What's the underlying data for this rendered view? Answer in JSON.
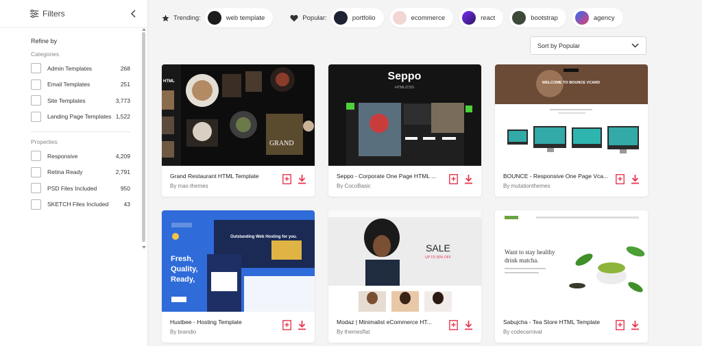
{
  "sidebar": {
    "title": "Filters",
    "refine_label": "Refine by",
    "categories_label": "Categories",
    "categories": [
      {
        "label": "Admin Templates",
        "count": "268"
      },
      {
        "label": "Email Templates",
        "count": "251"
      },
      {
        "label": "Site Templates",
        "count": "3,773"
      },
      {
        "label": "Landing Page Templates",
        "count": "1,522"
      }
    ],
    "properties_label": "Properties",
    "properties": [
      {
        "label": "Responsive",
        "count": "4,209"
      },
      {
        "label": "Retina Ready",
        "count": "2,791"
      },
      {
        "label": "PSD Files Included",
        "count": "950"
      },
      {
        "label": "SKETCH Files Included",
        "count": "43"
      }
    ]
  },
  "tags": {
    "trending_label": "Trending:",
    "trending": [
      {
        "label": "web template",
        "icon": "html-avatar"
      }
    ],
    "popular_label": "Popular:",
    "popular": [
      {
        "label": "portfolio",
        "icon": "portfolio-avatar"
      },
      {
        "label": "ecommerce",
        "icon": "ecommerce-avatar"
      },
      {
        "label": "react",
        "icon": "react-avatar"
      },
      {
        "label": "bootstrap",
        "icon": "bootstrap-avatar"
      },
      {
        "label": "agency",
        "icon": "agency-avatar"
      }
    ]
  },
  "sort": {
    "label": "Sort by Popular"
  },
  "cards": [
    {
      "title": "Grand Restaurant HTML Template",
      "author": "By max-themes",
      "thumb_text": "GRAND",
      "thumb_text2": "HTML"
    },
    {
      "title": "Seppo - Corporate One Page HTML ...",
      "author": "By CocoBasic",
      "thumb_text": "Seppo",
      "thumb_text2": "HTML/CSS"
    },
    {
      "title": "BOUNCE - Responsive One Page Vca...",
      "author": "By mutationthemes",
      "thumb_text": "WELCOME TO BOUNCE VCARD"
    },
    {
      "title": "Hustbee - Hosting Template",
      "author": "By brandio",
      "thumb_text": "Fresh, Quality, Ready,",
      "thumb_text2": "Outstanding Web Hosting for you."
    },
    {
      "title": "Modaz | Minimalist eCommerce HT...",
      "author": "By themesflat",
      "thumb_text": "SALE",
      "thumb_text2": "UP TO 30% OFF"
    },
    {
      "title": "Sabujcha - Tea Store HTML Template",
      "author": "By codecarnival",
      "thumb_text": "Want to stay healthy drink matcha."
    }
  ],
  "colors": {
    "accent": "#e8344e",
    "sidebar_bg": "#ffffff",
    "page_bg": "#f4f4f4"
  }
}
